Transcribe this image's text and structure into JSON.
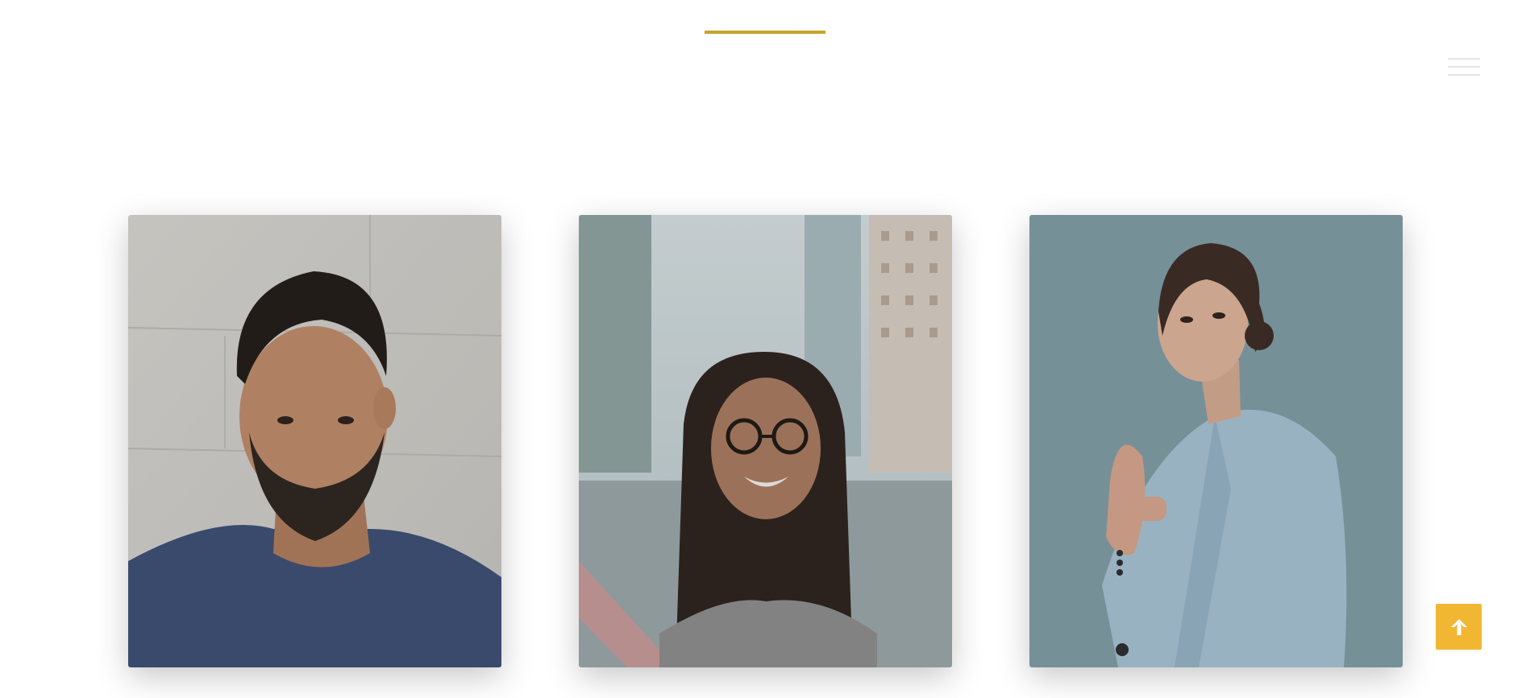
{
  "header": {
    "accent_color": "#c9a227",
    "menu_icon": "hamburger-icon"
  },
  "team": {
    "members": [
      {
        "photo": "portrait-bearded-man-blue-tshirt"
      },
      {
        "photo": "portrait-smiling-woman-glasses-street"
      },
      {
        "photo": "portrait-woman-light-blue-blazer-pointing"
      }
    ]
  },
  "back_to_top": {
    "icon": "arrow-up-icon",
    "color": "#f2b732"
  }
}
